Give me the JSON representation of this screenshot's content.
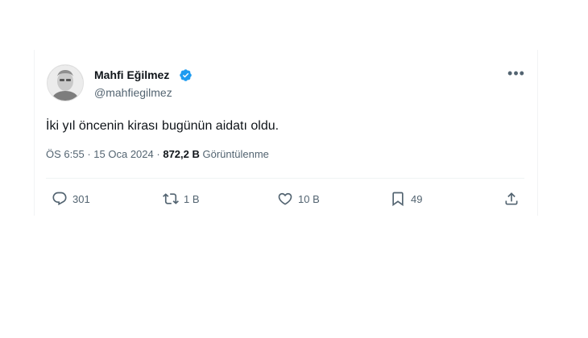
{
  "author": {
    "name": "Mahfi Eğilmez",
    "handle": "@mahfiegilmez",
    "verified": true
  },
  "tweet": {
    "text": "İki yıl öncenin kirası bugünün aidatı oldu."
  },
  "meta": {
    "time": "ÖS 6:55",
    "separator1": "·",
    "date": "15 Oca 2024",
    "separator2": "·",
    "views_count": "872,2 B",
    "views_label": "Görüntülenme"
  },
  "actions": {
    "replies": "301",
    "retweets": "1 B",
    "likes": "10 B",
    "bookmarks": "49"
  },
  "colors": {
    "verified_blue": "#1d9bf0",
    "secondary_text": "#536471",
    "primary_text": "#0f1419"
  },
  "icons": [
    "verified-badge-icon",
    "more-icon",
    "reply-icon",
    "retweet-icon",
    "like-icon",
    "bookmark-icon",
    "share-icon"
  ]
}
